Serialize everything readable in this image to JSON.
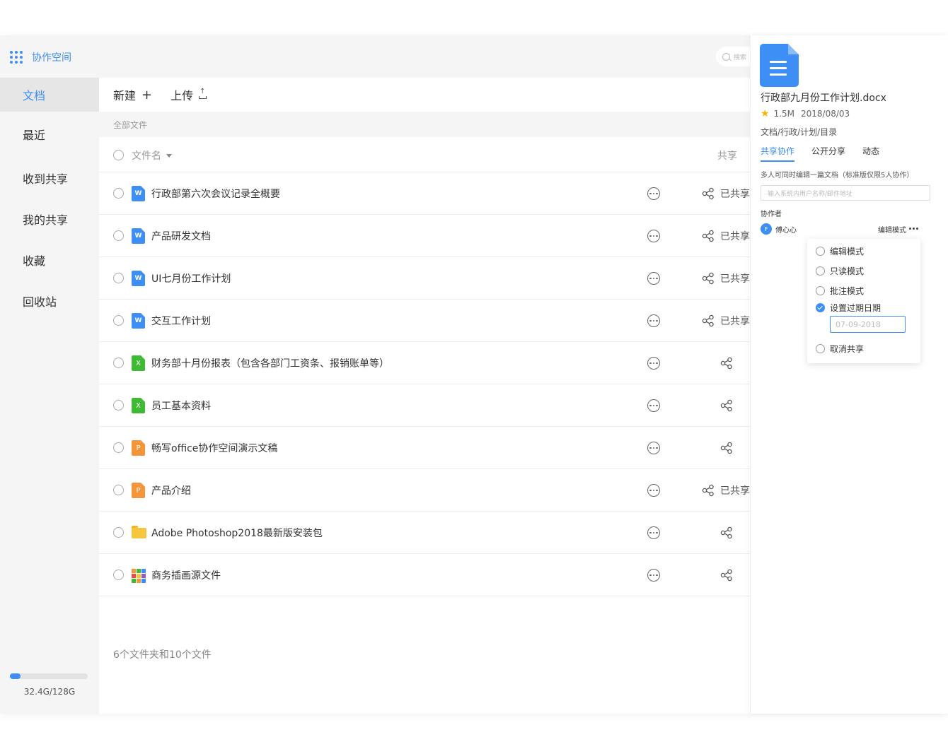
{
  "app": {
    "title": "协作空间"
  },
  "search": {
    "placeholder": "搜索"
  },
  "sidebar": {
    "items": [
      {
        "label": "文档",
        "active": true
      },
      {
        "label": "最近"
      },
      {
        "label": "收到共享"
      },
      {
        "label": "我的共享"
      },
      {
        "label": "收藏"
      },
      {
        "label": "回收站"
      }
    ],
    "storage": {
      "text": "32.4G/128G",
      "used_fraction": 0.14
    }
  },
  "toolbar": {
    "new_label": "新建",
    "upload_label": "上传"
  },
  "breadcrumb": {
    "label": "全部文件"
  },
  "table": {
    "header_name": "文件名",
    "header_share": "共享",
    "rows": [
      {
        "name": "行政部第六次会议记录全概要",
        "type": "w",
        "icon_label": "W",
        "shared": "已共享"
      },
      {
        "name": "产品研发文档",
        "type": "w",
        "icon_label": "W",
        "shared": "已共享"
      },
      {
        "name": "UI七月份工作计划",
        "type": "w",
        "icon_label": "W",
        "shared": "已共享"
      },
      {
        "name": "交互工作计划",
        "type": "w",
        "icon_label": "W",
        "shared": "已共享"
      },
      {
        "name": "财务部十月份报表（包含各部门工资条、报销账单等）",
        "type": "x",
        "icon_label": "X",
        "shared": ""
      },
      {
        "name": "员工基本资料",
        "type": "x",
        "icon_label": "X",
        "shared": ""
      },
      {
        "name": "畅写office协作空间演示文稿",
        "type": "p",
        "icon_label": "P",
        "shared": ""
      },
      {
        "name": "产品介绍",
        "type": "p",
        "icon_label": "P",
        "shared": "已共享"
      },
      {
        "name": "Adobe Photoshop2018最新版安装包",
        "type": "folder",
        "icon_label": "",
        "shared": ""
      },
      {
        "name": "商务插画源文件",
        "type": "img",
        "icon_label": "",
        "shared": ""
      }
    ],
    "summary": "6个文件夹和10个文件"
  },
  "panel": {
    "file_name": "行政部九月份工作计划.docx",
    "size": "1.5M",
    "date": "2018/08/03",
    "path": "文档/行政/计划/目录",
    "tabs": [
      "共享协作",
      "公开分享",
      "动态"
    ],
    "note": "多人可同时编辑一篇文档（标准版仅限5人协作）",
    "input_placeholder": "输入系统内用户名称/邮件地址",
    "collaborators_label": "协作者",
    "collaborator": {
      "avatar": "F",
      "name": "傅心心",
      "mode": "编辑模式"
    },
    "menu": {
      "items": [
        "编辑模式",
        "只读模式",
        "批注模式",
        "设置过期日期",
        "取消共享"
      ],
      "date_placeholder": "07-09-2018"
    }
  },
  "colors": {
    "accent": "#3d8ef5",
    "excel": "#3fba35",
    "ppt": "#f5953a",
    "folder": "#f7c640",
    "star": "#f5b400"
  }
}
